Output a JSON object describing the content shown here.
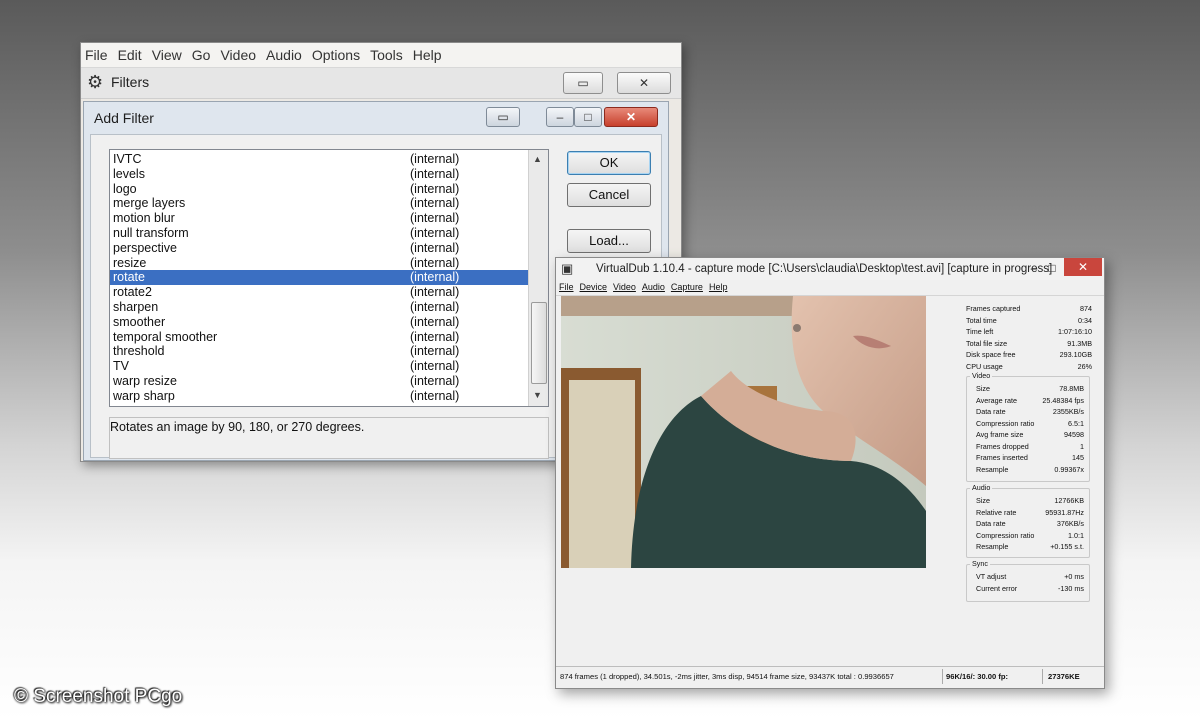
{
  "main_window": {
    "menu": [
      "File",
      "Edit",
      "View",
      "Go",
      "Video",
      "Audio",
      "Options",
      "Tools",
      "Help"
    ],
    "filters_title": "Filters"
  },
  "add_filter": {
    "title": "Add Filter",
    "filters": [
      {
        "name": "IVTC",
        "type": "(internal)"
      },
      {
        "name": "levels",
        "type": "(internal)"
      },
      {
        "name": "logo",
        "type": "(internal)"
      },
      {
        "name": "merge layers",
        "type": "(internal)"
      },
      {
        "name": "motion blur",
        "type": "(internal)"
      },
      {
        "name": "null transform",
        "type": "(internal)"
      },
      {
        "name": "perspective",
        "type": "(internal)"
      },
      {
        "name": "resize",
        "type": "(internal)"
      },
      {
        "name": "rotate",
        "type": "(internal)"
      },
      {
        "name": "rotate2",
        "type": "(internal)"
      },
      {
        "name": "sharpen",
        "type": "(internal)"
      },
      {
        "name": "smoother",
        "type": "(internal)"
      },
      {
        "name": "temporal smoother",
        "type": "(internal)"
      },
      {
        "name": "threshold",
        "type": "(internal)"
      },
      {
        "name": "TV",
        "type": "(internal)"
      },
      {
        "name": "warp resize",
        "type": "(internal)"
      },
      {
        "name": "warp sharp",
        "type": "(internal)"
      }
    ],
    "selected_index": 8,
    "description": "Rotates an image by 90, 180, or 270 degrees.",
    "ok_label": "OK",
    "cancel_label": "Cancel",
    "load_label": "Load..."
  },
  "virtualdub": {
    "title": "VirtualDub 1.10.4 - capture mode [C:\\Users\\claudia\\Desktop\\test.avi] [capture in progress]",
    "menu": [
      "File",
      "Device",
      "Video",
      "Audio",
      "Capture",
      "Help"
    ],
    "stats": [
      {
        "label": "Frames captured",
        "value": "874"
      },
      {
        "label": "Total time",
        "value": "0:34"
      },
      {
        "label": "Time left",
        "value": "1:07:16:10"
      },
      {
        "label": "Total file size",
        "value": "91.3MB"
      },
      {
        "label": "Disk space free",
        "value": "293.10GB"
      },
      {
        "label": "CPU usage",
        "value": "26%"
      }
    ],
    "video_group": "Video",
    "video": [
      {
        "label": "Size",
        "value": "78.8MB"
      },
      {
        "label": "Average rate",
        "value": "25.48384 fps"
      },
      {
        "label": "Data rate",
        "value": "2355KB/s"
      },
      {
        "label": "Compression ratio",
        "value": "6.5:1"
      },
      {
        "label": "Avg frame size",
        "value": "94598"
      },
      {
        "label": "Frames dropped",
        "value": "1"
      },
      {
        "label": "Frames inserted",
        "value": "145"
      },
      {
        "label": "Resample",
        "value": "0.99367x"
      }
    ],
    "audio_group": "Audio",
    "audio": [
      {
        "label": "Size",
        "value": "12766KB"
      },
      {
        "label": "Relative rate",
        "value": "95931.87Hz"
      },
      {
        "label": "Data rate",
        "value": "376KB/s"
      },
      {
        "label": "Compression ratio",
        "value": "1.0:1"
      },
      {
        "label": "Resample",
        "value": "+0.155 s.t."
      }
    ],
    "sync_group": "Sync",
    "sync": [
      {
        "label": "VT adjust",
        "value": "+0 ms"
      },
      {
        "label": "Current error",
        "value": "-130 ms"
      }
    ],
    "status": {
      "main": "874 frames (1 dropped), 34.501s, -2ms jitter, 3ms disp, 94514 frame size, 93437K total : 0.9936657",
      "audio": "96K/16/: 30.00 fp:",
      "size": "27376KE"
    }
  },
  "credit": "© Screenshot PCgo",
  "colors": {
    "selection": "#3b6fc2",
    "close_red": "#c9463d"
  }
}
